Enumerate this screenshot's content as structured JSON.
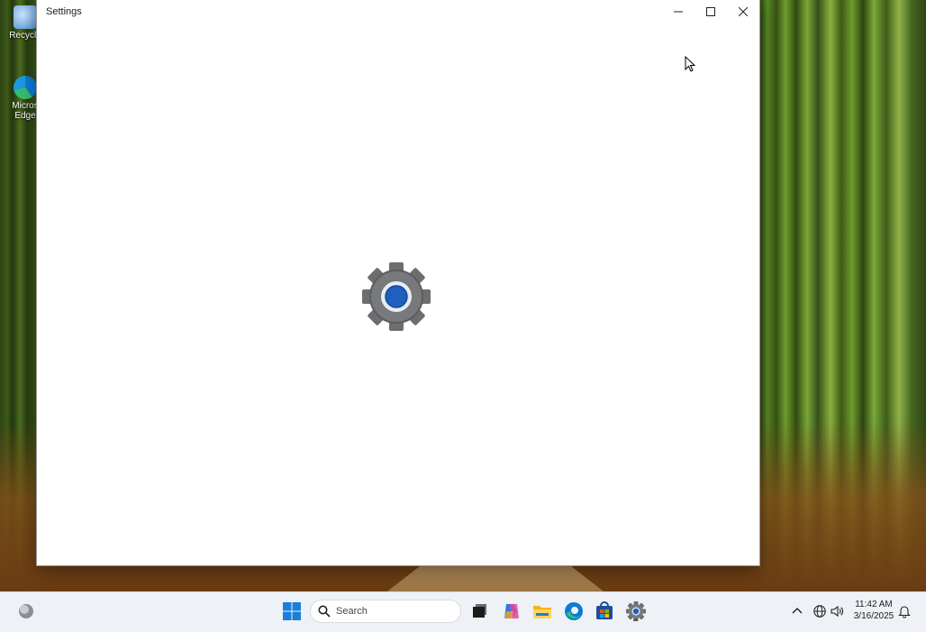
{
  "desktop": {
    "icons": [
      {
        "label": "Recycle"
      },
      {
        "label": "Micros\nEdge"
      }
    ]
  },
  "window": {
    "title": "Settings"
  },
  "taskbar": {
    "search_placeholder": "Search",
    "apps": [
      {
        "name": "start-icon"
      },
      {
        "name": "task-view-icon"
      },
      {
        "name": "copilot-icon"
      },
      {
        "name": "file-explorer-icon"
      },
      {
        "name": "edge-icon"
      },
      {
        "name": "store-icon"
      },
      {
        "name": "settings-icon",
        "active": true
      }
    ],
    "clock_time": "11:42 AM",
    "clock_date": "3/16/2025"
  },
  "colors": {
    "accent": "#1f5fbf",
    "window_bg": "#ffffff",
    "taskbar_bg": "#eef1f5"
  }
}
